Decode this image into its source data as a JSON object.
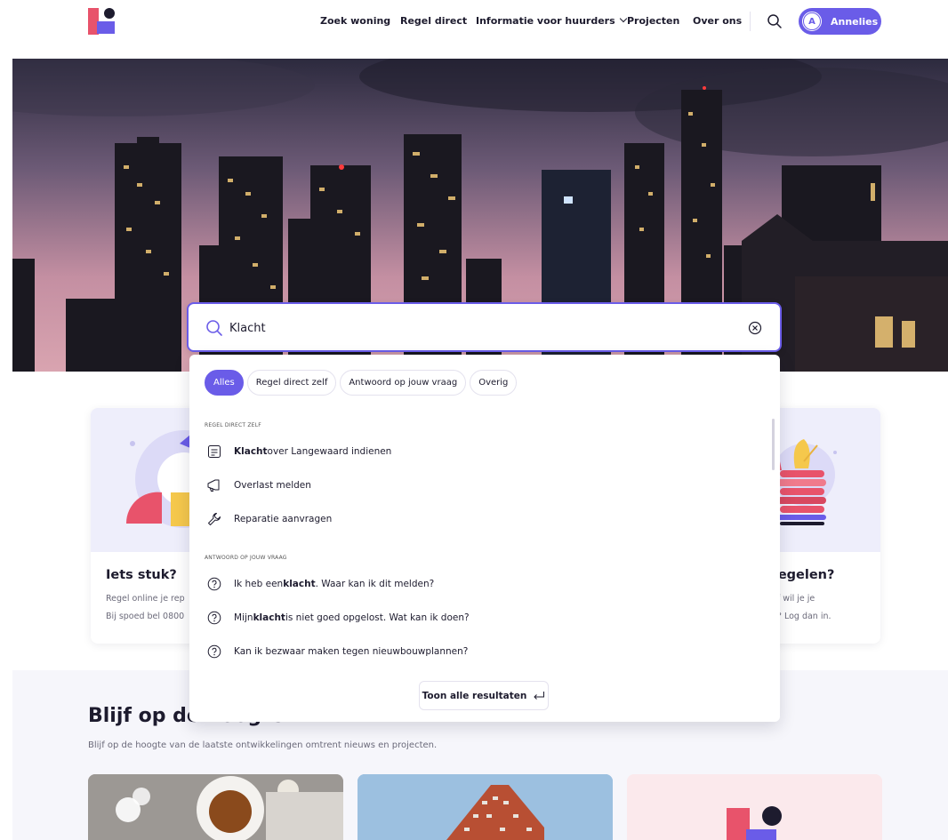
{
  "header": {
    "nav": [
      {
        "label": "Zoek woning"
      },
      {
        "label": "Regel direct"
      },
      {
        "label": "Informatie voor huurders"
      },
      {
        "label": "Projecten"
      },
      {
        "label": "Over ons"
      }
    ],
    "user": {
      "initial": "A",
      "name": "Annelies"
    }
  },
  "search": {
    "value": "Klacht",
    "filters": [
      "Alles",
      "Regel direct zelf",
      "Antwoord op jouw vraag",
      "Overig"
    ],
    "active_filter": "Alles",
    "sections": [
      {
        "label": "REGEL DIRECT ZELF",
        "items": [
          {
            "bold": "Klacht",
            "text": " over Langewaard indienen",
            "icon": "document-icon"
          },
          {
            "bold": "",
            "text": "Overlast melden",
            "icon": "megaphone-icon"
          },
          {
            "bold": "",
            "text": "Reparatie aanvragen",
            "icon": "wrench-icon"
          }
        ]
      },
      {
        "label": "ANTWOORD OP JOUW VRAAG",
        "items": [
          {
            "pre": "Ik heb een ",
            "bold": "klacht",
            "text": ". Waar kan ik dit melden?",
            "icon": "question-icon"
          },
          {
            "pre": "Mijn ",
            "bold": "klacht",
            "text": " is niet goed opgelost. Wat kan ik doen?",
            "icon": "question-icon"
          },
          {
            "pre": "",
            "bold": "",
            "text": "Kan ik bezwaar maken tegen nieuwbouwplannen?",
            "icon": "question-icon"
          }
        ]
      }
    ],
    "show_all_label": "Toon alle resultaten"
  },
  "cards": [
    {
      "title": "Iets stuk?",
      "line1": "Regel online je rep",
      "line2": "Bij spoed bel 0800"
    },
    {
      "title": "s regelen?",
      "line1": "n of wil je je",
      "line2": "gen? Log dan in."
    }
  ],
  "news_section": {
    "title": "Blijf op de hoogte",
    "subtitle": "Blijf op de hoogte van de laatste ontwikkelingen omtrent nieuws en projecten."
  },
  "colors": {
    "accent": "#6a5ce8",
    "brand_red": "#e8536b",
    "text": "#1d1b2e"
  }
}
